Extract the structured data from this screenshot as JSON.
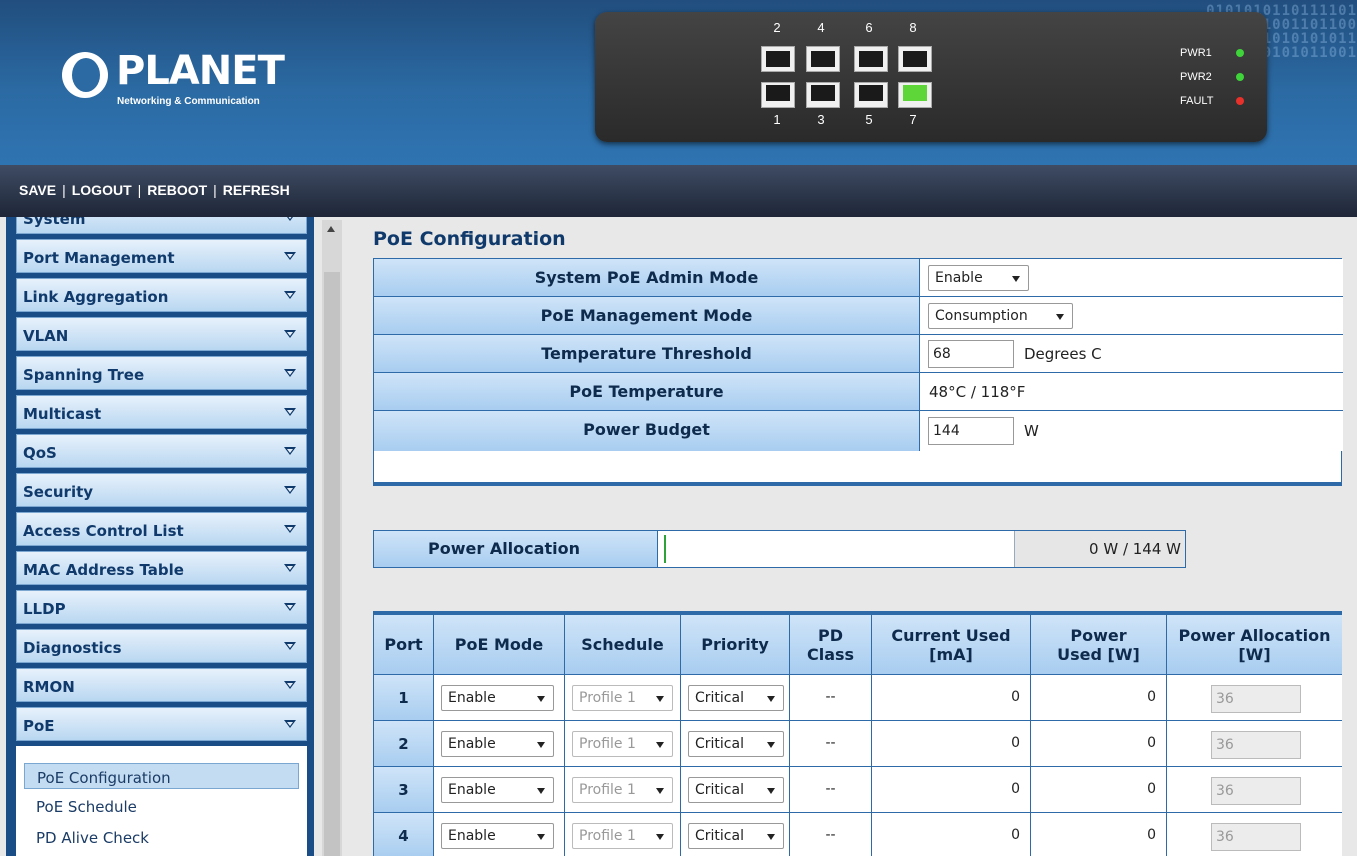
{
  "header": {
    "brand": "PLANET",
    "tagline": "Networking & Communication",
    "ports_top": [
      "2",
      "4",
      "6",
      "8"
    ],
    "ports_bottom": [
      "1",
      "3",
      "5",
      "7"
    ],
    "active_port": "7",
    "leds": [
      {
        "label": "PWR1",
        "color": "#3fd43a"
      },
      {
        "label": "PWR2",
        "color": "#3fd43a"
      },
      {
        "label": "FAULT",
        "color": "#e8312a"
      }
    ]
  },
  "toolbar": {
    "save": "SAVE",
    "logout": "LOGOUT",
    "reboot": "REBOOT",
    "refresh": "REFRESH",
    "sep": "|"
  },
  "sidebar": {
    "items": [
      {
        "label": "System"
      },
      {
        "label": "Port Management"
      },
      {
        "label": "Link Aggregation"
      },
      {
        "label": "VLAN"
      },
      {
        "label": "Spanning Tree"
      },
      {
        "label": "Multicast"
      },
      {
        "label": "QoS"
      },
      {
        "label": "Security"
      },
      {
        "label": "Access Control List"
      },
      {
        "label": "MAC Address Table"
      },
      {
        "label": "LLDP"
      },
      {
        "label": "Diagnostics"
      },
      {
        "label": "RMON"
      },
      {
        "label": "PoE"
      }
    ],
    "submenu": [
      "PoE Configuration",
      "PoE Schedule",
      "PD Alive Check"
    ],
    "active_submenu": "PoE Configuration"
  },
  "main": {
    "title": "PoE Configuration",
    "settings": {
      "admin_mode_label": "System PoE Admin Mode",
      "admin_mode_value": "Enable",
      "mgmt_mode_label": "PoE Management Mode",
      "mgmt_mode_value": "Consumption",
      "temp_threshold_label": "Temperature Threshold",
      "temp_threshold_value": "68",
      "temp_threshold_unit": "Degrees C",
      "poe_temp_label": "PoE Temperature",
      "poe_temp_value": "48°C / 118°F",
      "power_budget_label": "Power Budget",
      "power_budget_value": "144",
      "power_budget_unit": "W"
    },
    "allocation": {
      "label": "Power Allocation",
      "value": "0 W / 144 W",
      "fraction": 0
    },
    "table": {
      "headers": [
        "Port",
        "PoE Mode",
        "Schedule",
        "Priority",
        "PD Class",
        "Current Used [mA]",
        "Power Used [W]",
        "Power Allocation [W]"
      ],
      "rows": [
        {
          "port": "1",
          "mode": "Enable",
          "schedule": "Profile 1",
          "priority": "Critical",
          "pd_class": "--",
          "current": "0",
          "power": "0",
          "alloc": "36"
        },
        {
          "port": "2",
          "mode": "Enable",
          "schedule": "Profile 1",
          "priority": "Critical",
          "pd_class": "--",
          "current": "0",
          "power": "0",
          "alloc": "36"
        },
        {
          "port": "3",
          "mode": "Enable",
          "schedule": "Profile 1",
          "priority": "Critical",
          "pd_class": "--",
          "current": "0",
          "power": "0",
          "alloc": "36"
        },
        {
          "port": "4",
          "mode": "Enable",
          "schedule": "Profile 1",
          "priority": "Critical",
          "pd_class": "--",
          "current": "0",
          "power": "0",
          "alloc": "36"
        }
      ]
    }
  }
}
